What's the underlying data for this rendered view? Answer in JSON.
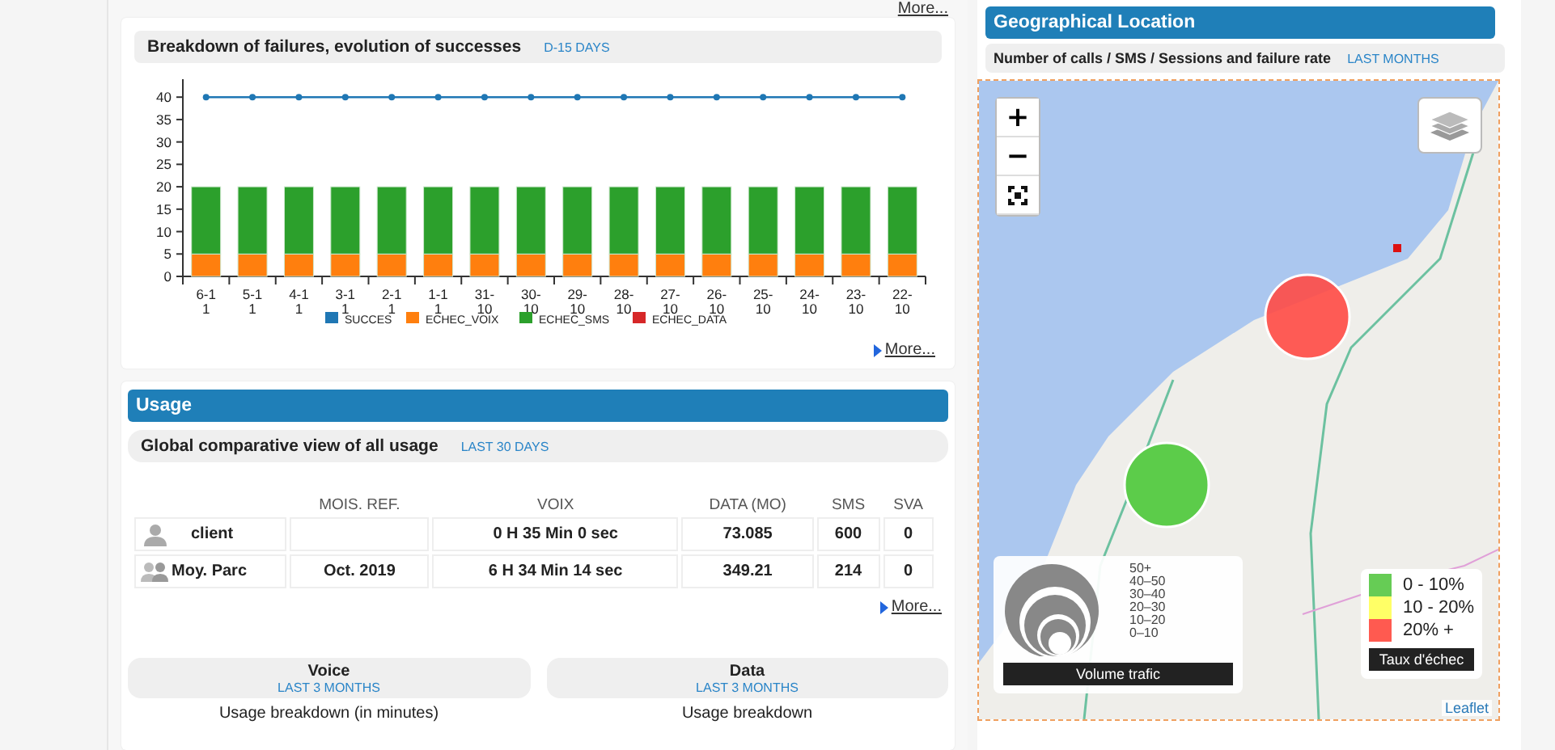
{
  "top_link": "More...",
  "failures": {
    "title": "Breakdown of failures, evolution of successes",
    "period": "D-15 DAYS",
    "more": "More...",
    "chart_data": {
      "type": "bar",
      "stacked": true,
      "legend": "bottom",
      "categories": [
        "6-11",
        "5-11",
        "4-11",
        "3-11",
        "2-11",
        "1-11",
        "31-10",
        "30-10",
        "29-10",
        "28-10",
        "27-10",
        "26-10",
        "25-10",
        "24-10",
        "23-10",
        "22-10"
      ],
      "ylim": [
        0,
        44
      ],
      "yticks": [
        0,
        5,
        10,
        15,
        20,
        25,
        30,
        35,
        40
      ],
      "series": [
        {
          "name": "SUCCES",
          "type": "line",
          "marker": true,
          "color": "#1f77b4",
          "values": [
            40,
            40,
            40,
            40,
            40,
            40,
            40,
            40,
            40,
            40,
            40,
            40,
            40,
            40,
            40,
            40
          ]
        },
        {
          "name": "ECHEC_VOIX",
          "type": "bar",
          "color": "#ff7f0e",
          "values": [
            5,
            5,
            5,
            5,
            5,
            5,
            5,
            5,
            5,
            5,
            5,
            5,
            5,
            5,
            5,
            5
          ]
        },
        {
          "name": "ECHEC_SMS",
          "type": "bar",
          "color": "#2ca02c",
          "values": [
            15,
            15,
            15,
            15,
            15,
            15,
            15,
            15,
            15,
            15,
            15,
            15,
            15,
            15,
            15,
            15
          ]
        },
        {
          "name": "ECHEC_DATA",
          "type": "bar",
          "color": "#d62728",
          "values": [
            0,
            0,
            0,
            0,
            0,
            0,
            0,
            0,
            0,
            0,
            0,
            0,
            0,
            0,
            0,
            0
          ]
        }
      ]
    }
  },
  "usage": {
    "title": "Usage",
    "subtitle": "Global comparative view of all usage",
    "period": "LAST 30 DAYS",
    "table": {
      "columns": [
        "MOIS. REF.",
        "VOIX",
        "DATA (MO)",
        "SMS",
        "SVA"
      ],
      "rows": [
        {
          "kind": "single",
          "name": "client",
          "cells": [
            "",
            "0 H 35 Min 0 sec",
            "73.085",
            "600",
            "0"
          ]
        },
        {
          "kind": "group",
          "name": "Moy. Parc",
          "cells": [
            "Oct. 2019",
            "6 H 34 Min 14 sec",
            "349.21",
            "214",
            "0"
          ]
        }
      ]
    },
    "more": "More...",
    "panels": [
      {
        "title": "Voice",
        "period": "LAST 3 MONTHS",
        "caption": "Usage breakdown (in minutes)"
      },
      {
        "title": "Data",
        "period": "LAST 3 MONTHS",
        "caption": "Usage breakdown"
      }
    ]
  },
  "geo": {
    "title": "Geographical Location",
    "subtitle": "Number of calls / SMS / Sessions and failure rate",
    "period": "LAST MONTHS",
    "map": {
      "zoom_in": "+",
      "zoom_out": "−",
      "volume_legend": {
        "labels": [
          "50+",
          "40–50",
          "30–40",
          "20–30",
          "10–20",
          "0–10"
        ],
        "title": "Volume trafic"
      },
      "failure_legend": {
        "items": [
          {
            "label": "0 - 10%",
            "color": "#66cc55"
          },
          {
            "label": "10 - 20%",
            "color": "#ffff66"
          },
          {
            "label": "20% +",
            "color": "#ff5a50"
          }
        ],
        "title": "Taux d'échec"
      },
      "attribution": "Leaflet"
    }
  }
}
